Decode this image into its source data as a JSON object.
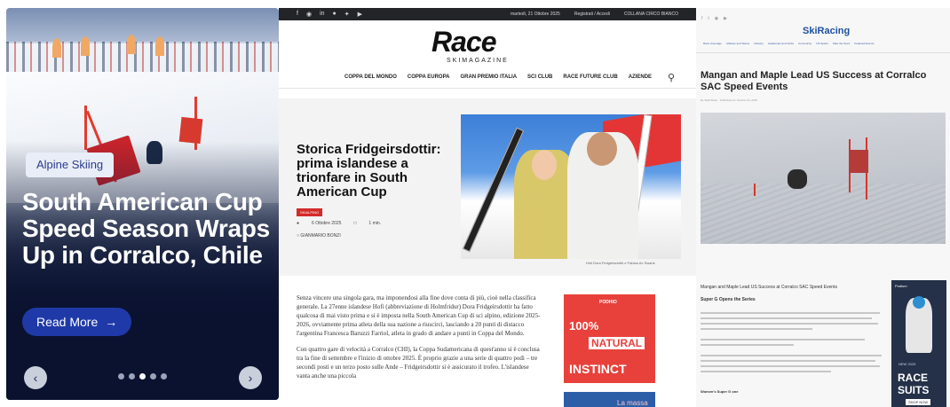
{
  "hero": {
    "tag": "Alpine Skiing",
    "title": "South American Cup Speed Season Wraps Up in Corralco, Chile",
    "read_more": "Read More",
    "prev_icon": "chevron-left-icon",
    "next_icon": "chevron-right-icon",
    "slide_count": 5,
    "active_slide": 3,
    "colors": {
      "accent": "#1f3aa8",
      "tag_text": "#2a3b8f",
      "overlay": "#0a1230"
    }
  },
  "race": {
    "logo": "Race",
    "logo_sub": "SKIMAGAZINE",
    "topbar": {
      "date": "martedì, 21 Ottobre 2025",
      "login": "Registrati / Accedi",
      "shop": "COLLANA CIRCO BIANCO"
    },
    "nav": [
      "COPPA DEL MONDO",
      "COPPA EUROPA",
      "GRAN PREMIO ITALIA",
      "SCI CLUB",
      "RACE FUTURE CLUB",
      "AZIENDE"
    ],
    "headline": "Storica Fridgeirsdottir: prima islandese a trionfare in South American Cup",
    "badge": "SKIALPINO",
    "date": "6 Ottobre 2025",
    "read_time": "1 min.",
    "author": "GIANMARIO BONZI",
    "caption": "Holl Dora Fridgeirsdottir e Fabian Ax Swartz",
    "paragraphs": [
      "Senza vincere una singola gara, ma imponendosi alla fine dove conta di più, cioè nella classifica generale. La 27enne islandese Hofi (abbreviazione di Holmfridur) Dora Fridgeirsdottir ha fatto qualcosa di mai visto prima e si è imposta nella South American Cup di sci alpino, edizione 2025-2026, ovviamente prima atleta della sua nazione a riuscirci, lasciando a 20 punti di distacco l'argentina Francesca Baruzzi Farriol, atleta in grado di andare a punti in Coppa del Mondo.",
      "Con quattro gare di velocità a Corralco (CHI), la Coppa Sudamericana di quest'anno si è conclusa tra la fine di settembre e l'inizio di ottobre 2025. È proprio grazie a una serie di quattro podi – tre secondi posti e un terzo posto sulle Ande – Fridgeirsdottir si è assicurato il trofeo. L'islandese vanta anche una piccola"
    ],
    "ad": {
      "brand": "PODHIO",
      "line1": "100%",
      "line2": "NATURAL",
      "line3": "INSTINCT"
    },
    "ad2": "La massa",
    "colors": {
      "topbar": "#222428",
      "badge": "#d32a2a",
      "ad": "#e8413b"
    }
  },
  "skir": {
    "logo": "SkiRacing",
    "nav": [
      "Race Coverage",
      "Athletes and Teams",
      "Industry",
      "Academies and Clubs",
      "Community",
      "US Sports",
      "Take the Team",
      "Featured Events"
    ],
    "title": "Mangan and Maple Lead US Success at Corralco SAC Speed Events",
    "byline": "By Staff Writer · Published On October 03, 2025",
    "sub": "Mangan and Maple Lead US Success at Corralco SAC Speed Events",
    "h2": "Super G Opens the Series",
    "h3": "Women's Super G one",
    "ad": {
      "top": "Podium",
      "date": "NEW 2025",
      "line1": "RACE",
      "line2": "SUITS",
      "shop": "SHOP NOW"
    },
    "colors": {
      "logo": "#1d4fa1",
      "ad": "#243148"
    }
  }
}
